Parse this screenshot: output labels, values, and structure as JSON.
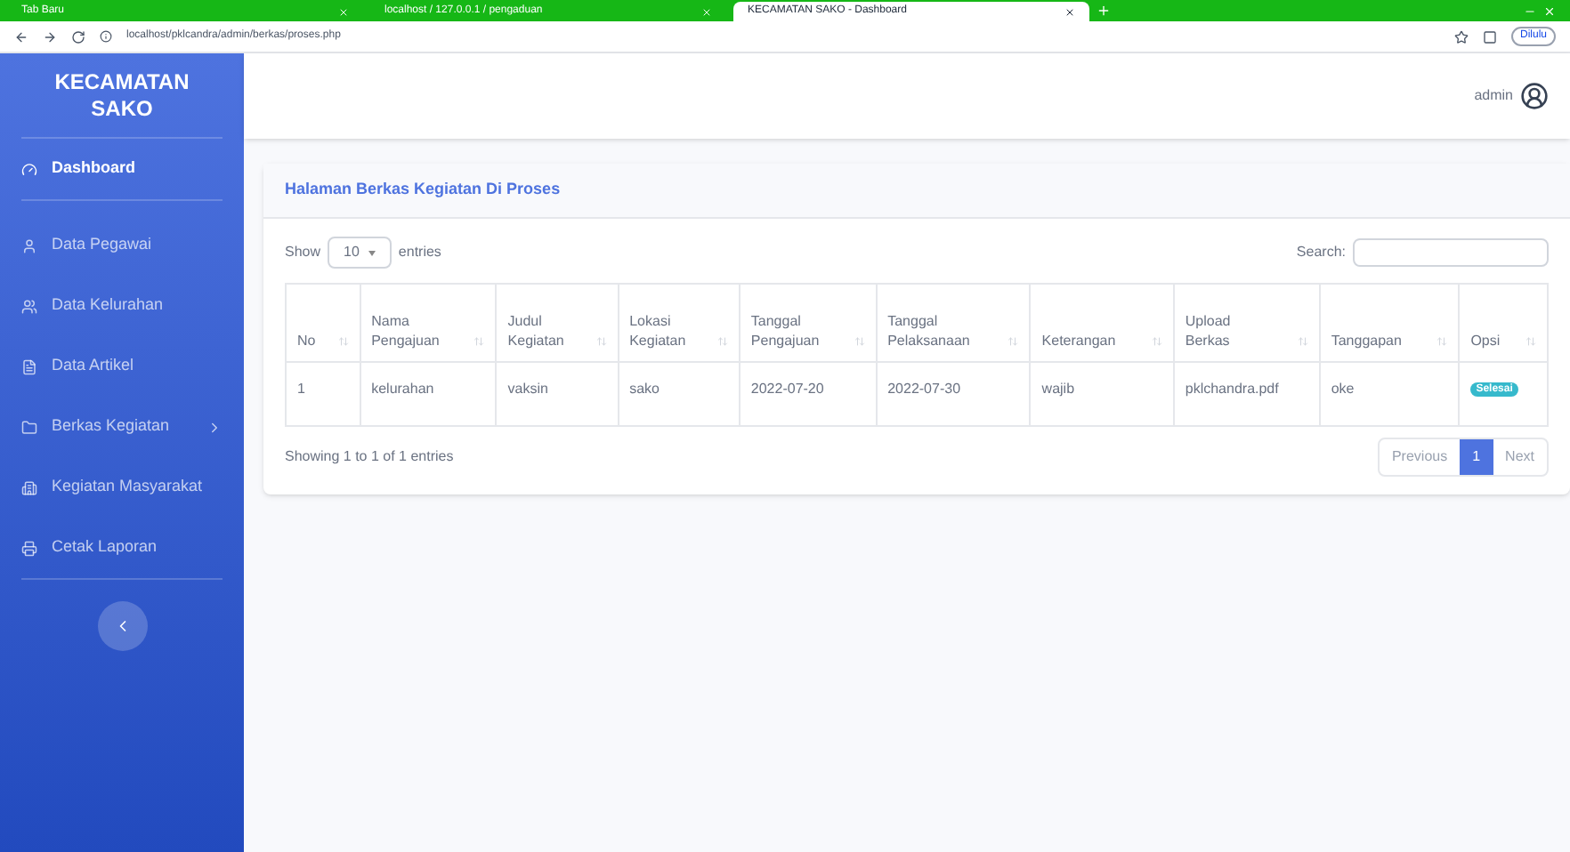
{
  "browser": {
    "tabs": [
      {
        "label": "Tab Baru",
        "selected": false
      },
      {
        "label": "localhost / 127.0.0.1 / pengaduan",
        "selected": false
      },
      {
        "label": "KECAMATAN SAKO - Dashboard",
        "selected": true
      }
    ],
    "url": "localhost/pklcandra/admin/berkas/proses.php",
    "profile": "Dilulu"
  },
  "sidebar": {
    "brand": "KECAMATAN SAKO",
    "items": [
      {
        "label": "Dashboard",
        "selected": true
      },
      {
        "label": "Data Pegawai",
        "selected": false
      },
      {
        "label": "Data Kelurahan",
        "selected": false
      },
      {
        "label": "Data Artikel",
        "selected": false
      },
      {
        "label": "Berkas Kegiatan",
        "selected": false,
        "has_submenu": true
      },
      {
        "label": "Kegiatan Masyarakat",
        "selected": false
      },
      {
        "label": "Cetak Laporan",
        "selected": false
      }
    ]
  },
  "topbar": {
    "user": "admin"
  },
  "card": {
    "title": "Halaman Berkas Kegiatan Di Proses",
    "show_label": "Show",
    "page_size": "10",
    "entries_label": "entries",
    "search_label": "Search:",
    "table": {
      "columns": [
        "No",
        "Nama Pengajuan",
        "Judul Kegiatan",
        "Lokasi Kegiatan",
        "Tanggal Pengajuan",
        "Tanggal Pelaksanaan",
        "Keterangan",
        "Upload Berkas",
        "Tanggapan",
        "Opsi"
      ],
      "rows": [
        {
          "cells": [
            "1",
            "kelurahan",
            "vaksin",
            "sako",
            "2022-07-20",
            "2022-07-30",
            "wajib",
            "pklchandra.pdf",
            "oke"
          ],
          "status": "Selesai"
        }
      ]
    },
    "info": "Showing 1 to 1 of 1 entries",
    "pagination": [
      {
        "label": "Previous",
        "selected": false
      },
      {
        "label": "1",
        "selected": true
      },
      {
        "label": "Next",
        "selected": false
      }
    ]
  }
}
